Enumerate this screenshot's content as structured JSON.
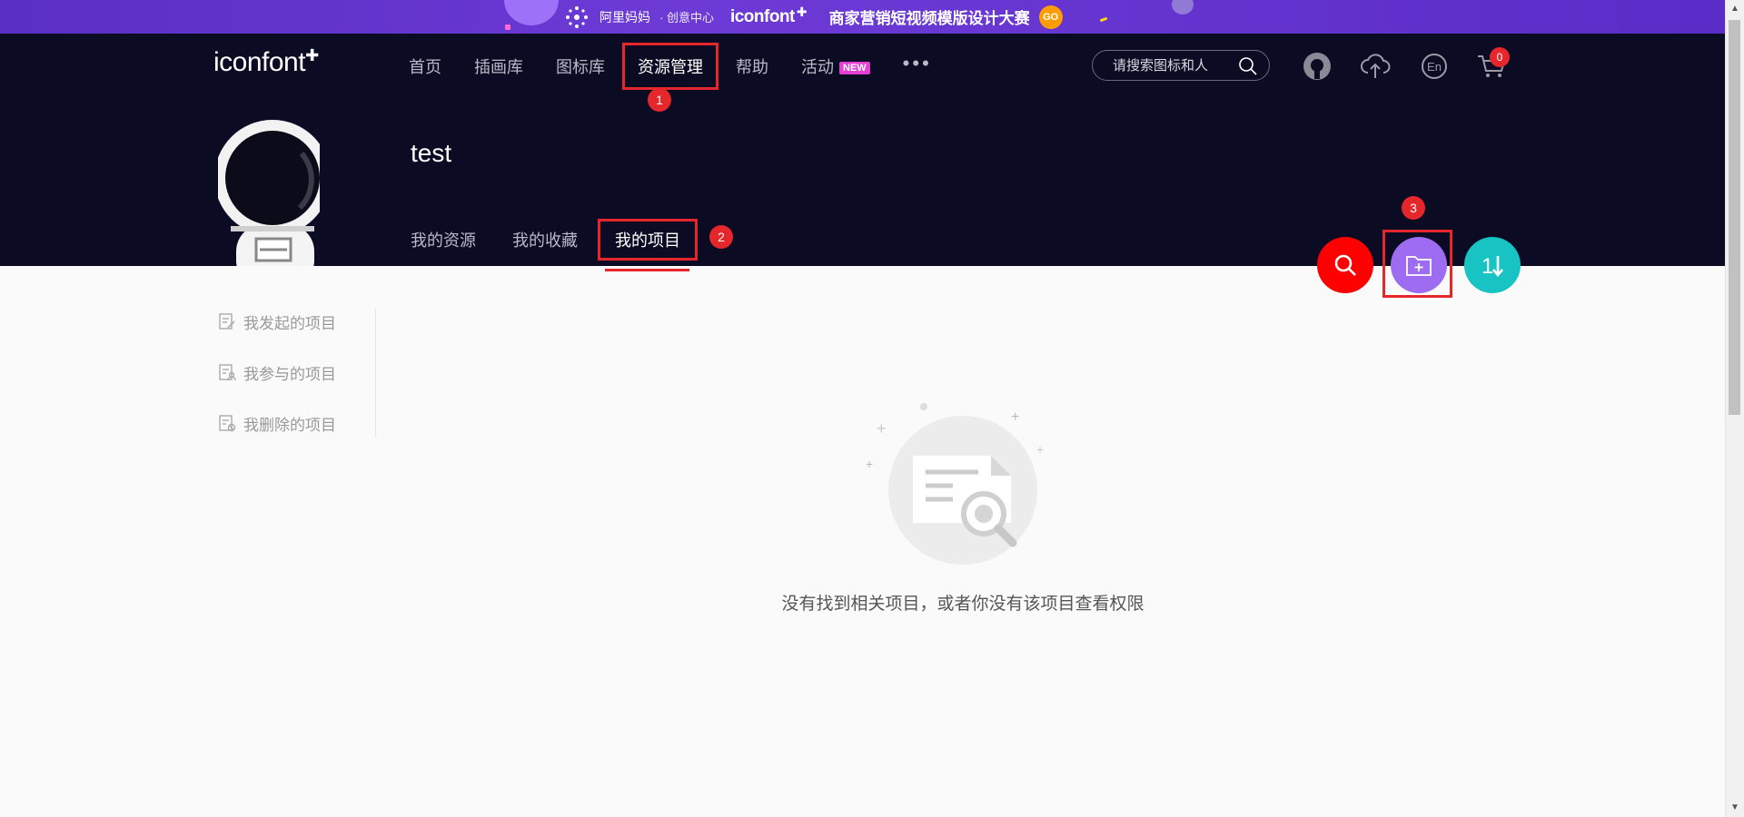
{
  "banner": {
    "alimama": "阿里妈妈",
    "sub": "· 创意中心",
    "brand": "iconfont",
    "slogan": "商家营销短视频模版设计大赛",
    "go": "GO"
  },
  "header": {
    "logo": "iconfont",
    "nav": [
      {
        "label": "首页"
      },
      {
        "label": "插画库"
      },
      {
        "label": "图标库"
      },
      {
        "label": "资源管理"
      },
      {
        "label": "帮助"
      },
      {
        "label": "活动"
      }
    ],
    "new_badge": "NEW",
    "more": "•••",
    "search_placeholder": "请搜索图标和人",
    "cart_count": "0"
  },
  "steps": {
    "one": "1",
    "two": "2",
    "three": "3"
  },
  "profile": {
    "username": "test",
    "tabs": [
      {
        "label": "我的资源"
      },
      {
        "label": "我的收藏"
      },
      {
        "label": "我的项目"
      }
    ]
  },
  "sidebar": {
    "items": [
      {
        "label": "我发起的项目"
      },
      {
        "label": "我参与的项目"
      },
      {
        "label": "我删除的项目"
      }
    ]
  },
  "empty": {
    "message": "没有找到相关项目，或者你没有该项目查看权限"
  }
}
